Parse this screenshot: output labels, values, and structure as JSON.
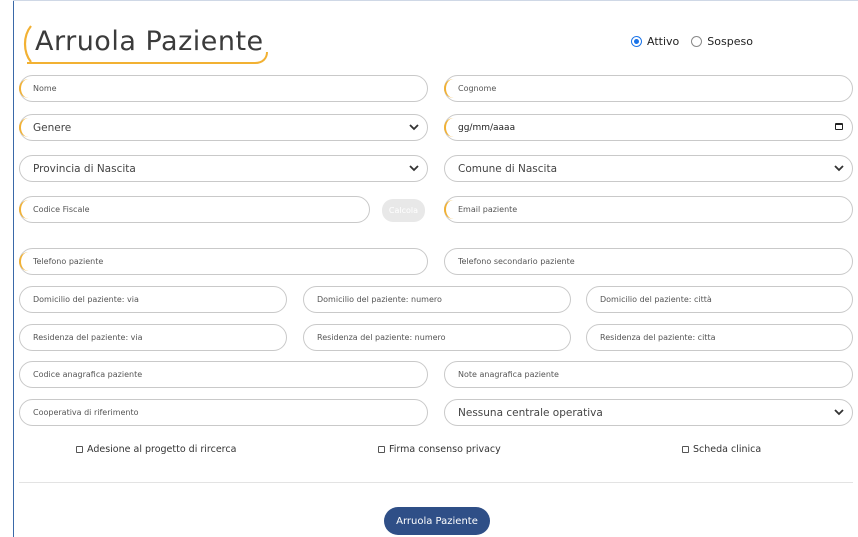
{
  "form": {
    "title": "Arruola Paziente",
    "status": {
      "active_label": "Attivo",
      "suspended_label": "Sospeso",
      "selected": "Attivo"
    },
    "nome": "Nome",
    "cognome": "Cognome",
    "genere": "Genere",
    "data_nascita": "gg/mm/aaaa",
    "provincia_nascita": "Provincia di Nascita",
    "comune_nascita": "Comune di Nascita",
    "codice_fiscale": "Codice Fiscale",
    "calcola_label": "Calcola",
    "email": "Email paziente",
    "telefono": "Telefono paziente",
    "telefono_secondario": "Telefono secondario paziente",
    "domicilio_via": "Domicilio del paziente: via",
    "domicilio_numero": "Domicilio del paziente: numero",
    "domicilio_citta": "Domicilio del paziente: città",
    "residenza_via": "Residenza del paziente: via",
    "residenza_numero": "Residenza del paziente: numero",
    "residenza_citta": "Residenza del paziente: citta",
    "codice_anagrafica": "Codice anagrafica paziente",
    "note_anagrafica": "Note anagrafica paziente",
    "cooperativa": "Cooperativa di riferimento",
    "centrale_operativa": "Nessuna centrale operativa",
    "checkboxes": {
      "ricerca": "Adesione al progetto di rircerca",
      "privacy": "Firma consenso privacy",
      "scheda": "Scheda clinica"
    },
    "submit_label": "Arruola Paziente"
  },
  "colors": {
    "accent": "#f2b133",
    "primary": "#2f4f87",
    "radio": "#1a73e8"
  }
}
